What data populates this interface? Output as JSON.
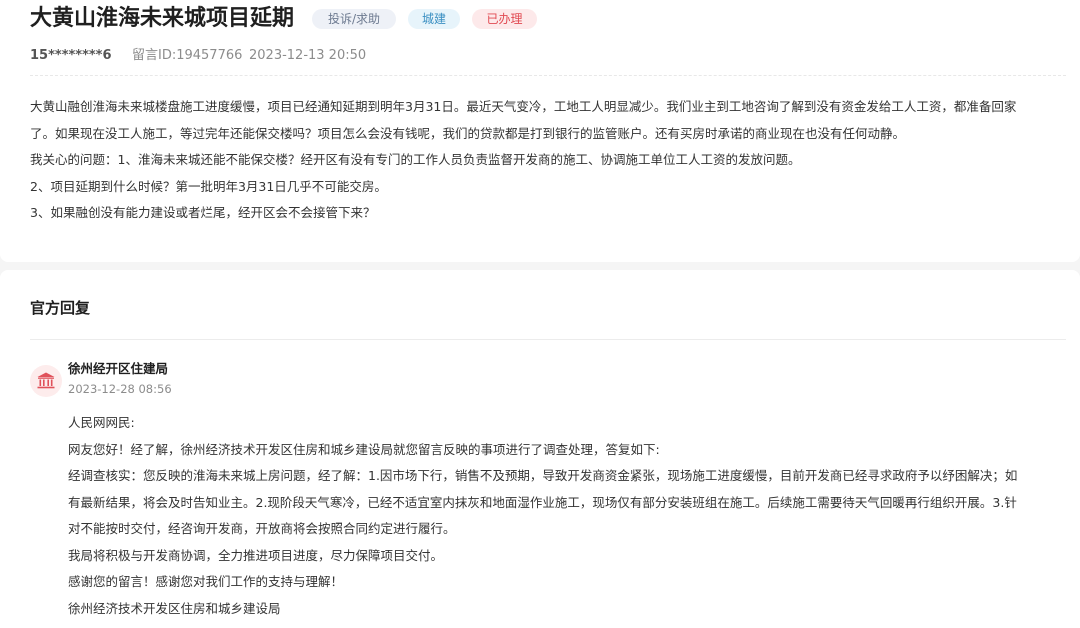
{
  "post": {
    "title": "大黄山淮海未来城项目延期",
    "tags": {
      "type": "投诉/求助",
      "category": "城建",
      "status": "已办理"
    },
    "user": "15********6",
    "message_id": "留言ID:19457766",
    "datetime": "2023-12-13 20:50",
    "lines": [
      "大黄山融创淮海未来城楼盘施工进度缓慢，项目已经通知延期到明年3月31日。最近天气变冷，工地工人明显减少。我们业主到工地咨询了解到没有资金发给工人工资，都准备回家",
      "了。如果现在没工人施工，等过完年还能保交楼吗？项目怎么会没有钱呢，我们的贷款都是打到银行的监管账户。还有买房时承诺的商业现在也没有任何动静。",
      "我关心的问题：1、淮海未来城还能不能保交楼？经开区有没有专门的工作人员负责监督开发商的施工、协调施工单位工人工资的发放问题。",
      "2、项目延期到什么时候？第一批明年3月31日几乎不可能交房。",
      "3、如果融创没有能力建设或者烂尾，经开区会不会接管下来？"
    ]
  },
  "reply": {
    "section_title": "官方回复",
    "org_icon": "government-building-icon",
    "org_name": "徐州经开区住建局",
    "datetime": "2023-12-28 08:56",
    "lines": [
      "人民网网民:",
      "网友您好！经了解，徐州经济技术开发区住房和城乡建设局就您留言反映的事项进行了调查处理，答复如下:",
      "经调查核实：您反映的淮海未来城上房问题，经了解：1.因市场下行，销售不及预期，导致开发商资金紧张，现场施工进度缓慢，目前开发商已经寻求政府予以纾困解决；如",
      "有最新结果，将会及时告知业主。2.现阶段天气寒冷，已经不适宜室内抹灰和地面湿作业施工，现场仅有部分安装班组在施工。后续施工需要待天气回暖再行组织开展。3.针",
      "对不能按时交付，经咨询开发商，开放商将会按照合同约定进行履行。",
      "我局将积极与开发商协调，全力推进项目进度，尽力保障项目交付。",
      "感谢您的留言！感谢您对我们工作的支持与理解！",
      "徐州经济技术开发区住房和城乡建设局"
    ]
  },
  "colors": {
    "tag_type_bg": "#eef1f7",
    "tag_category_bg": "#e7f4fb",
    "tag_status_bg": "#fde9ea",
    "status_text": "#e14a52",
    "avatar_icon": "#e0515a"
  }
}
